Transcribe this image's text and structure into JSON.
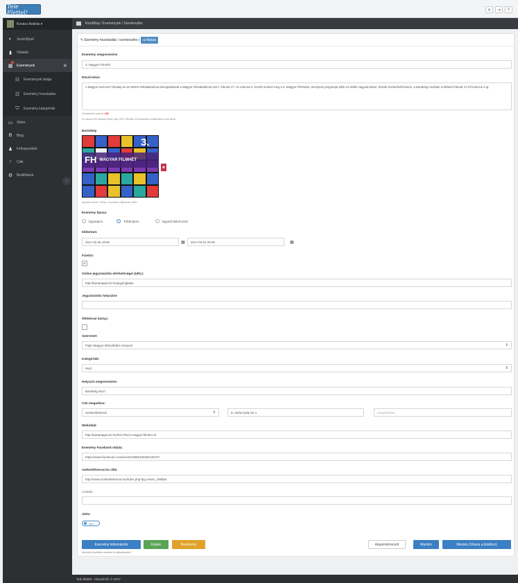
{
  "app": {
    "logo": "Tele Élettel!"
  },
  "toolbar": {
    "icons": [
      "fullscreen-icon",
      "logout-icon",
      "menu-icon"
    ]
  },
  "sidebar": {
    "user": "Kovács András",
    "items": [
      {
        "label": "Vezérlőpult",
        "icon": "dashboard-icon"
      },
      {
        "label": "Oldalak",
        "icon": "pages-icon"
      },
      {
        "label": "Események",
        "icon": "events-icon",
        "active": true
      },
      {
        "label": "Slider",
        "icon": "slider-icon"
      },
      {
        "label": "Blog",
        "icon": "blog-icon"
      },
      {
        "label": "Felhasználók",
        "icon": "users-icon"
      },
      {
        "label": "Cikk",
        "icon": "article-icon"
      },
      {
        "label": "Beállítások",
        "icon": "settings-icon"
      }
    ],
    "subitems": [
      "Események listája",
      "Esemény hozzáadás",
      "Esemény kategóriák"
    ]
  },
  "breadcrumb": [
    "Kezdőlap",
    "Események",
    "Szerkesztés"
  ],
  "panel": {
    "title": "Esemény hozzáadás / szerkesztés",
    "back_label": "Vissza"
  },
  "form": {
    "name_label": "Esemény megnevezése",
    "name_value": "3. Magyar Filmhét",
    "desc_label": "Rövid leírás",
    "desc_value": "A Magyar Nemzeti Filmalap és az NMHH Médiatanácsa támogatásával a Magyar Filmakadémia 2017. február 27. és március 5. között rendezi meg a 3. Magyar Filmhetet, amelynek programja több 10 vidéki nagyvárosban, köztük Székesfehérváron, a Barátság moziban is látható február 27-től március 4-ig.",
    "char_count_label": "Karakterek száma:",
    "char_count": "282",
    "char_hint": "Az oldalon 200 karakter jelenik meg. SEO: Ötlenten 300 karakteres tartalmakat a rövid leírás",
    "cover_label": "Borítókép",
    "cover_text_main": "FH",
    "cover_text_sub": "MAGYAR FILMHÉT",
    "cover_number": "3.",
    "cover_hint": "Ajánlott méret: 300px, maximum fájlméret: 8Mb",
    "type_label": "Esemény típusa:",
    "type_options": [
      "Egynapos",
      "Többnapos",
      "Egyedi dátumozás"
    ],
    "type_selected": 1,
    "duration_label": "Időtartam:",
    "date_start": "2017.02.26 19:00",
    "date_end": "2017.03.04 20:00",
    "paid_label": "Fizetős:",
    "paid_checked": true,
    "ticket_url_label": "Online jegyvásárlás elérhetőségei (URL):",
    "ticket_url_value": "http://baratsagmozi.hu/jegyfoglalas",
    "ticket_place_label": "Jegyvásárlás helyszíne",
    "ticket_place_value": "",
    "card_label": "Öfehérvár kártya:",
    "org_label": "Szervezet:",
    "org_value": "Pajkr Magyar Művelődési Központ",
    "cat_label": "Kategóriák:",
    "cat_value": "Mozi",
    "venue_label": "Helyszín megnevezése:",
    "venue_value": "Barátság Mozi",
    "address_label": "Cím megadása:",
    "city_value": "Székesfehérvár",
    "street_value": "III. Béla király tér 1.",
    "zip_placeholder": "Irányítószám",
    "web_label": "Weboldal:",
    "web_value": "http://baratsagmozi.hu/2017/01/3-magyar-filmhet-2/",
    "fb_label": "Esemény Facebook oldala:",
    "fb_value": "https://www.facebook.com/events/386634028218470/",
    "link_label": "szekesfehervar.hu cikk:",
    "link_value": "http://www.szekesfehervar.hu/index.php?pg=news_198654",
    "tags_label": "Címkék",
    "tags_value": "",
    "active_label": "Aktív:",
    "active_toggle": "Igen"
  },
  "buttons": {
    "info": "Esemény információk",
    "images": "Képek",
    "recurring": "Rendezés",
    "preview": "Alapértelmezett",
    "save": "Mentés",
    "save_back": "Mentés (Vissza a listához)"
  },
  "footnote": "Mentést követően mentse el változásokat!",
  "footer": "Tele Élettel - Absurd Kft. © 2017",
  "colors": {
    "accent": "#4f8fc3",
    "sidebar": "#2e2f33",
    "success": "#5aa456",
    "warning": "#e0a22b"
  }
}
